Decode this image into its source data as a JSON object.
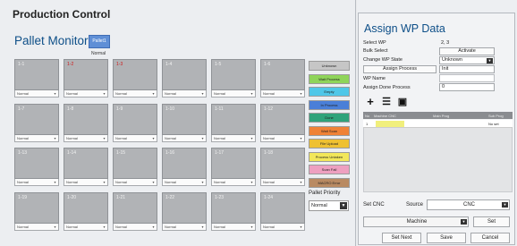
{
  "app": {
    "title": "Production Control"
  },
  "monitor": {
    "section_title": "Pallet Monitor",
    "pallet_button": "Pallet1",
    "pallet_state": "Normal",
    "cells": [
      {
        "label": "1-1",
        "select": "Normal",
        "label_color": "white"
      },
      {
        "label": "1-2",
        "select": "Normal",
        "label_color": "red"
      },
      {
        "label": "1-3",
        "select": "Normal",
        "label_color": "red"
      },
      {
        "label": "1-4",
        "select": "Normal",
        "label_color": "white"
      },
      {
        "label": "1-5",
        "select": "Normal",
        "label_color": "white"
      },
      {
        "label": "1-6",
        "select": "Normal",
        "label_color": "white"
      },
      {
        "label": "1-7",
        "select": "Normal",
        "label_color": "white"
      },
      {
        "label": "1-8",
        "select": "Normal",
        "label_color": "white"
      },
      {
        "label": "1-9",
        "select": "Normal",
        "label_color": "white"
      },
      {
        "label": "1-10",
        "select": "Normal",
        "label_color": "white"
      },
      {
        "label": "1-11",
        "select": "Normal",
        "label_color": "white"
      },
      {
        "label": "1-12",
        "select": "Normal",
        "label_color": "white"
      },
      {
        "label": "1-13",
        "select": "Normal",
        "label_color": "white"
      },
      {
        "label": "1-14",
        "select": "Normal",
        "label_color": "white"
      },
      {
        "label": "1-15",
        "select": "Normal",
        "label_color": "white"
      },
      {
        "label": "1-16",
        "select": "Normal",
        "label_color": "white"
      },
      {
        "label": "1-17",
        "select": "Normal",
        "label_color": "white"
      },
      {
        "label": "1-18",
        "select": "Normal",
        "label_color": "white"
      },
      {
        "label": "1-19",
        "select": "Normal",
        "label_color": "white"
      },
      {
        "label": "1-20",
        "select": "Normal",
        "label_color": "white"
      },
      {
        "label": "1-21",
        "select": "Normal",
        "label_color": "white"
      },
      {
        "label": "1-22",
        "select": "Normal",
        "label_color": "white"
      },
      {
        "label": "1-23",
        "select": "Normal",
        "label_color": "white"
      },
      {
        "label": "1-24",
        "select": "Normal",
        "label_color": "white"
      }
    ],
    "legend": [
      {
        "label": "Unknown",
        "color": "#c6c6c6"
      },
      {
        "label": "Wait Process",
        "color": "#8fd45a"
      },
      {
        "label": "Empty",
        "color": "#4fc7e8"
      },
      {
        "label": "In Process",
        "color": "#4a7fd8"
      },
      {
        "label": "Done",
        "color": "#2fa37a"
      },
      {
        "label": "Wait Scan",
        "color": "#ef8236"
      },
      {
        "label": "File Upload",
        "color": "#efc132"
      },
      {
        "label": "Process Untaken",
        "color": "#f2e75a"
      },
      {
        "label": "Scan Fail",
        "color": "#eea0c0"
      },
      {
        "label": "MACRO Error",
        "color": "#b98a62"
      }
    ],
    "priority_label": "Pallet Priority",
    "priority_value": "Normal"
  },
  "assign": {
    "title": "Assign WP Data",
    "select_wp_label": "Select WP",
    "select_wp_value": "2, 3",
    "bulk_select_label": "Bulk Select",
    "activate_button": "Activate",
    "change_state_label": "Change WP State",
    "state_value": "Unknown",
    "assign_process_button": "Assign Process",
    "init_value": "Init",
    "wp_name_label": "WP Name",
    "assign_done_label": "Assign Done Process",
    "assign_done_value": "0",
    "table_headers": [
      "No",
      "Machine CNC",
      "Main Prog",
      "Sub Prog"
    ],
    "table_rows": [
      {
        "no": "1",
        "sub": "No set"
      }
    ],
    "set_cnc_label": "Set CNC",
    "source_label": "Source",
    "source_value": "CNC",
    "machine_value": "Machine",
    "set_button": "Set",
    "set_next_button": "Set Next",
    "save_button": "Save",
    "cancel_button": "Cancel"
  }
}
